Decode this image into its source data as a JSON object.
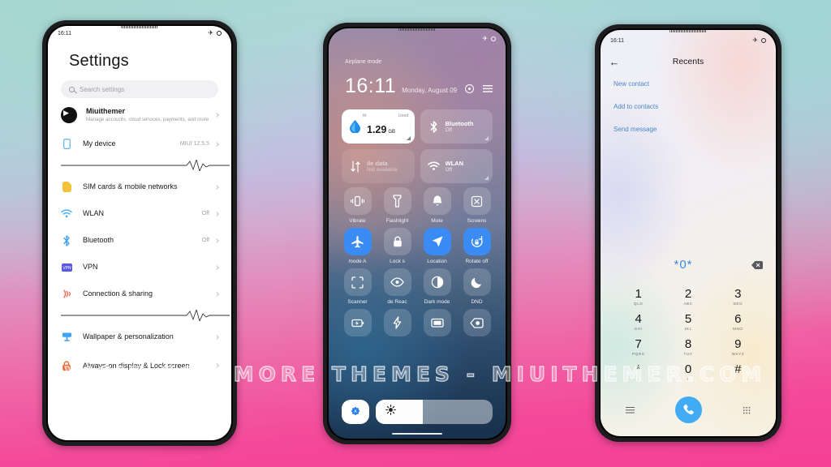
{
  "background": {
    "top_color": "#a9d8d4",
    "bottom_color": "#f54096"
  },
  "watermark": {
    "text": "VISIT FOR MORE THEMES - MIUITHEMER.COM"
  },
  "phone_left": {
    "status": {
      "time": "16:11",
      "airplane_icon": "airplane-icon",
      "ring_icon": "circle-icon"
    },
    "title": "Settings",
    "search": {
      "placeholder": "Search settings",
      "icon": "search-icon"
    },
    "account": {
      "name": "Miuithemer",
      "subtitle": "Manage accounts, cloud services, payments, and more"
    },
    "items": [
      {
        "label": "My device",
        "value": "MIUI 12.5.5",
        "icon": "phone-icon",
        "color": "#6ab7f0"
      },
      {
        "label": "SIM cards & mobile networks",
        "value": "",
        "icon": "sim-icon",
        "color": "#f5c23d"
      },
      {
        "label": "WLAN",
        "value": "Off",
        "icon": "wifi-icon",
        "color": "#4aaef0"
      },
      {
        "label": "Bluetooth",
        "value": "Off",
        "icon": "bluetooth-icon",
        "color": "#3f9ff0"
      },
      {
        "label": "VPN",
        "value": "",
        "icon": "vpn-icon",
        "color": "#5659e8"
      },
      {
        "label": "Connection & sharing",
        "value": "",
        "icon": "connection-icon",
        "color": "#ef6a5a"
      },
      {
        "label": "Wallpaper & personalization",
        "value": "",
        "icon": "wallpaper-icon",
        "color": "#3fa2ef"
      },
      {
        "label": "Always-on display & Lock screen",
        "value": "",
        "icon": "lock-icon",
        "color": "#ef6a3c"
      }
    ]
  },
  "phone_center": {
    "status_label": "Airplane mode",
    "status_icons": [
      "airplane-icon",
      "circle-icon"
    ],
    "clock": {
      "time": "16:11",
      "date": "Monday, August 09"
    },
    "header_actions": [
      "settings-gear-icon",
      "menu-icon"
    ],
    "cards": [
      {
        "name": "data-usage-card",
        "state": "on",
        "icon": "water-drop-icon",
        "header_left": "th",
        "header_right": "Used",
        "value": "1.29",
        "unit": "GB",
        "title": "",
        "subtitle": ""
      },
      {
        "name": "bluetooth-card",
        "state": "dim",
        "icon": "bluetooth-icon",
        "title": "Bluetooth",
        "subtitle": "Off"
      },
      {
        "name": "mobile-data-card",
        "state": "off",
        "icon": "data-arrows-icon",
        "title": "ile data",
        "subtitle": "Not available"
      },
      {
        "name": "wlan-card",
        "state": "dim",
        "icon": "wifi-icon",
        "title": "WLAN",
        "subtitle": "Off"
      }
    ],
    "tiles": [
      {
        "label": "Vibrate",
        "icon": "vibrate-icon",
        "active": false
      },
      {
        "label": "Flashlight",
        "icon": "flashlight-icon",
        "active": false
      },
      {
        "label": "Mute",
        "icon": "bell-icon",
        "active": false
      },
      {
        "label": "Screens",
        "icon": "screenshot-icon",
        "active": false
      },
      {
        "label": "mode    A",
        "icon": "airplane-icon",
        "active": true
      },
      {
        "label": "Lock s",
        "icon": "padlock-icon",
        "active": false
      },
      {
        "label": "Location",
        "icon": "navigation-icon",
        "active": true
      },
      {
        "label": "Rotate off",
        "icon": "rotate-lock-icon",
        "active": true
      },
      {
        "label": "Scanner",
        "icon": "scan-frame-icon",
        "active": false
      },
      {
        "label": "de    Reac",
        "icon": "eye-icon",
        "active": false
      },
      {
        "label": "Dark mode",
        "icon": "contrast-icon",
        "active": false
      },
      {
        "label": "DND",
        "icon": "moon-icon",
        "active": false
      },
      {
        "label": "",
        "icon": "battery-saver-icon",
        "active": false
      },
      {
        "label": "",
        "icon": "lightning-icon",
        "active": false
      },
      {
        "label": "",
        "icon": "cast-screen-icon",
        "active": false
      },
      {
        "label": "",
        "icon": "tag-icon",
        "active": false
      }
    ],
    "brightness": {
      "auto_icon": "auto-brightness-icon",
      "slider_icon": "sun-icon",
      "level_percent": 40
    }
  },
  "phone_right": {
    "status": {
      "time": "16:11",
      "airplane_icon": "airplane-icon",
      "ring_icon": "circle-icon"
    },
    "back_icon": "back-arrow-icon",
    "title": "Recents",
    "links": [
      "New contact",
      "Add to contacts",
      "Send message"
    ],
    "number_input": {
      "value": "*0*",
      "delete_icon": "backspace-icon"
    },
    "keypad": [
      {
        "digit": "1",
        "sub": "QLD"
      },
      {
        "digit": "2",
        "sub": "ABC"
      },
      {
        "digit": "3",
        "sub": "DEG"
      },
      {
        "digit": "4",
        "sub": "GHI"
      },
      {
        "digit": "5",
        "sub": "JKL"
      },
      {
        "digit": "6",
        "sub": "MNO"
      },
      {
        "digit": "7",
        "sub": "PQRS"
      },
      {
        "digit": "8",
        "sub": "TUV"
      },
      {
        "digit": "9",
        "sub": "WXYZ"
      },
      {
        "digit": "*",
        "sub": ","
      },
      {
        "digit": "0",
        "sub": "+"
      },
      {
        "digit": "#",
        "sub": ""
      }
    ],
    "bottom_bar": [
      "menu-icon",
      "call-button-icon",
      "keypad-icon"
    ]
  }
}
